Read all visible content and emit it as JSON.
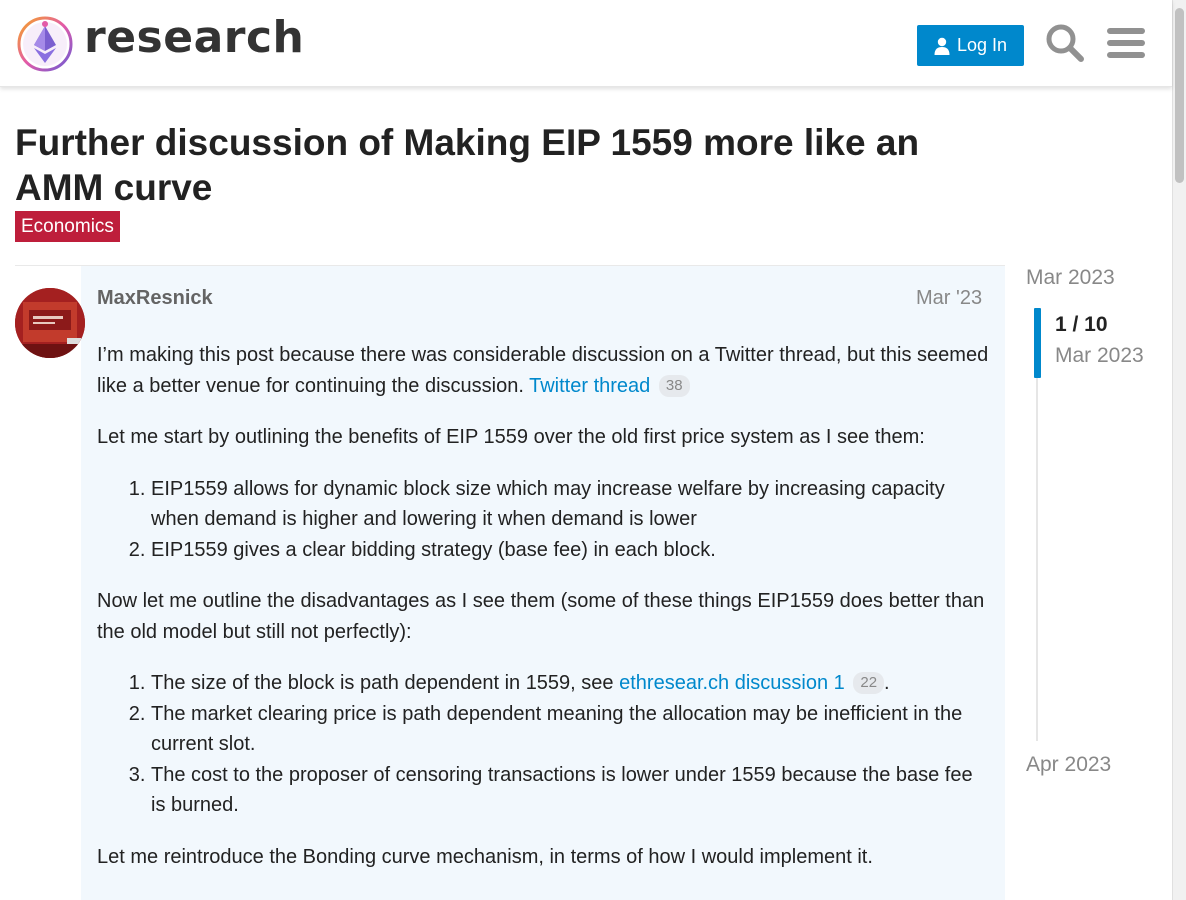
{
  "header": {
    "site_name": "research",
    "login_label": "Log In"
  },
  "topic": {
    "title": "Further discussion of Making EIP 1559 more like an AMM curve",
    "category": "Economics"
  },
  "post": {
    "username": "MaxResnick",
    "date": "Mar '23",
    "p1_text": "I’m making this post because there was considerable discussion on a Twitter thread, but this seemed like a better venue for continuing the discussion. ",
    "p1_link": "Twitter thread",
    "p1_link_count": "38",
    "p2": "Let me start by outlining the benefits of EIP 1559 over the old first price system as I see them:",
    "benefits": [
      "EIP1559 allows for dynamic block size which may increase welfare by increasing capacity when demand is higher and lowering it when demand is lower",
      "EIP1559 gives a clear bidding strategy (base fee) in each block."
    ],
    "p3": "Now let me outline the disadvantages as I see them (some of these things EIP1559 does better than the old model but still not perfectly):",
    "disadv1_text": "The size of the block is path dependent in 1559, see ",
    "disadv1_link": "ethresear.ch discussion 1",
    "disadv1_count": "22",
    "disadv1_end": ".",
    "disadv2": "The market clearing price is path dependent meaning the allocation may be inefficient in the current slot.",
    "disadv3": "The cost to the proposer of censoring transactions is lower under 1559 because the base fee is burned.",
    "p4": "Let me reintroduce the Bonding curve mechanism, in terms of how I would implement it."
  },
  "timeline": {
    "start": "Mar 2023",
    "position": "1 / 10",
    "position_date": "Mar 2023",
    "end": "Apr 2023"
  },
  "colors": {
    "accent": "#0088cc",
    "category": "#be1e3b",
    "post_bg": "#f2f8fd"
  }
}
